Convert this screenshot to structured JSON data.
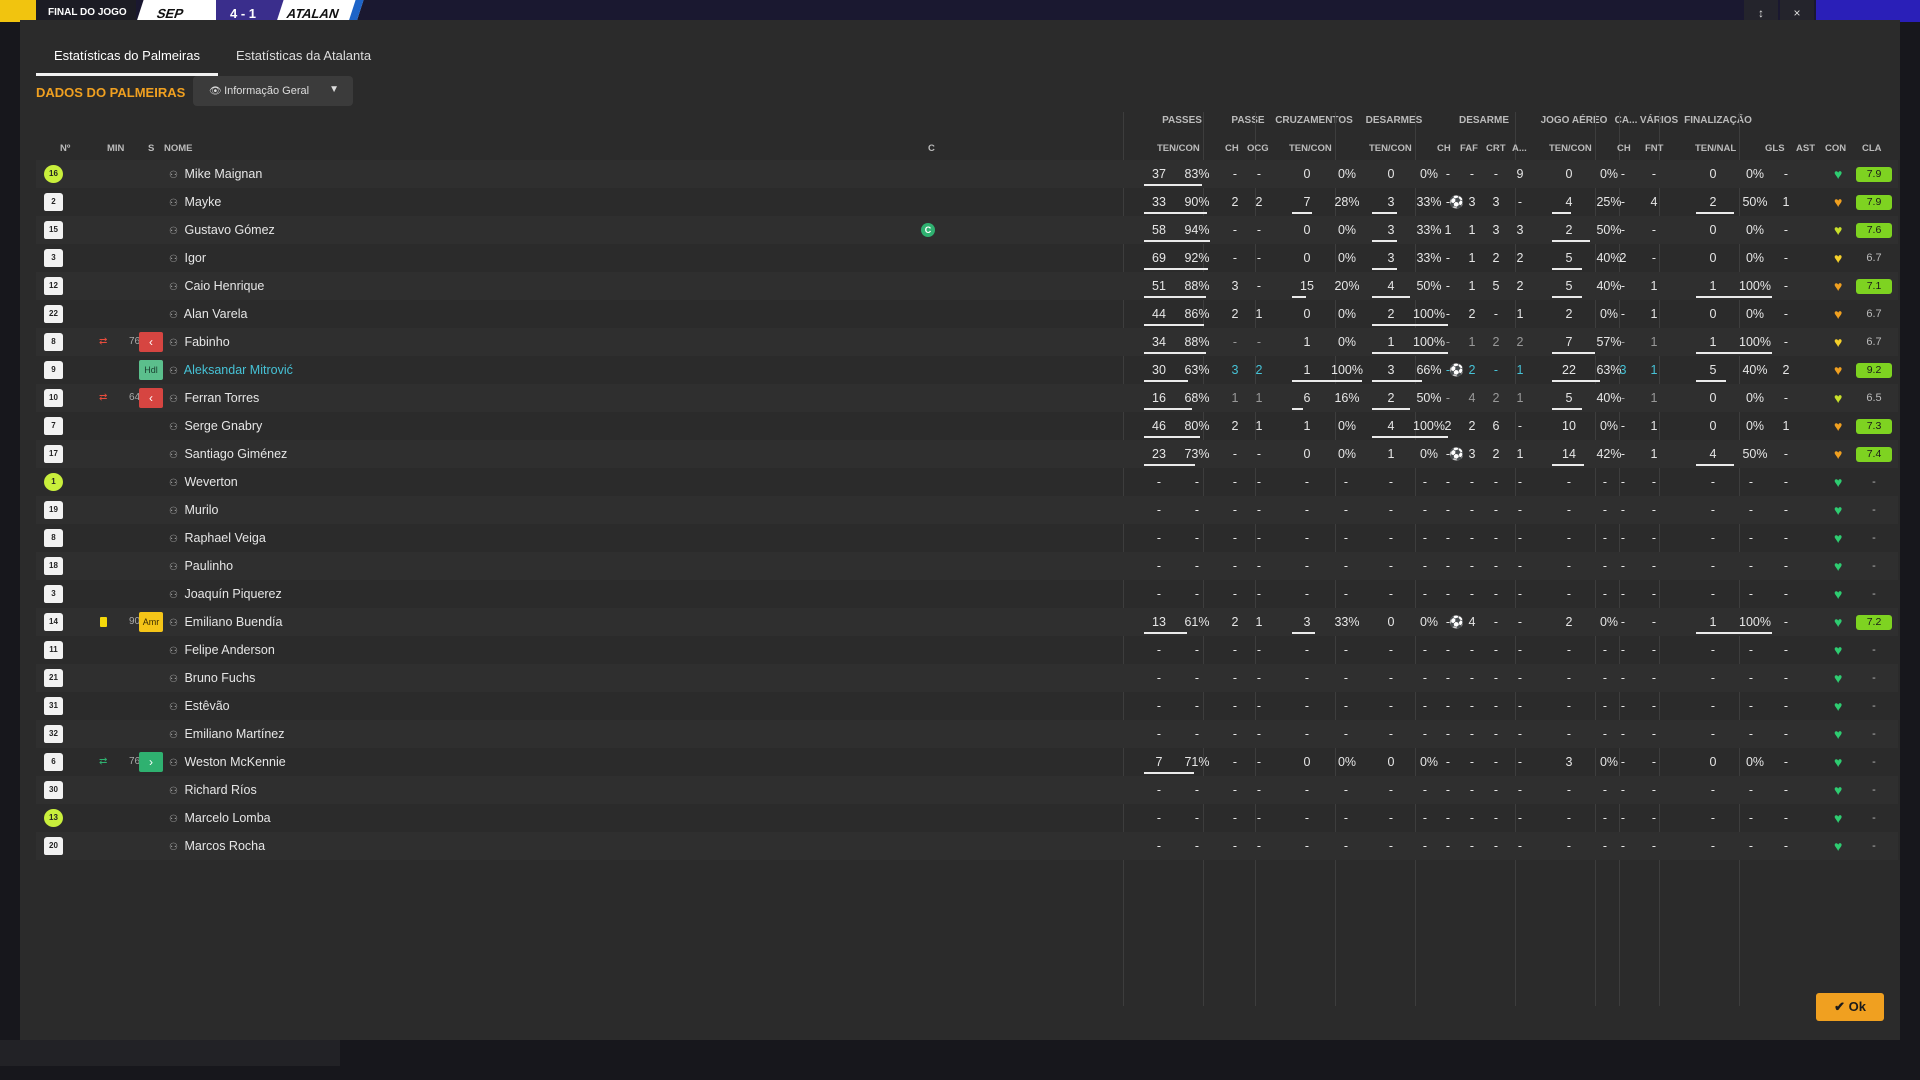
{
  "header": {
    "status": "FINAL DO JOGO",
    "home": "SEP",
    "score": "4 - 1",
    "away": "ATALAN",
    "ctrl_a": "↕",
    "ctrl_b": "×"
  },
  "tabs": [
    {
      "label": "Estatísticas do Palmeiras",
      "active": true
    },
    {
      "label": "Estatísticas da Atalanta",
      "active": false
    }
  ],
  "section_title": "DADOS DO PALMEIRAS",
  "view_select": {
    "value": "Informação Geral",
    "icon": "eye-icon"
  },
  "groups": {
    "passes": "PASSES",
    "passe": "PASSE",
    "cruzamentos": "CRUZAMENTOS",
    "desarmes": "DESARMES",
    "desarme": "DESARME",
    "jogo_aereo": "JOGO AÉREO",
    "ca": "CA...",
    "varios": "VÁRIOS",
    "finalizacao": "FINALIZAÇÃO"
  },
  "columns": {
    "num": "Nº",
    "min": "MIN",
    "s": "S",
    "nome": "NOME",
    "c": "C",
    "passes": "TEN/CON",
    "passe_ch": "CH",
    "passe_ocg": "OCG",
    "cruz": "TEN/CON",
    "des": "TEN/CON",
    "desarme_ch": "CH",
    "faf": "FAF",
    "crt": "CRT",
    "a": "A...",
    "aereo": "TEN/CON",
    "ca_ch": "CH",
    "fnt": "FNT",
    "fin": "TEN/NAL",
    "gls": "GLS",
    "ast": "AST",
    "con": "CON",
    "cla": "CLA"
  },
  "players": [
    {
      "num": "16",
      "gk": true,
      "name": "Mike Maignan",
      "p": [
        "37",
        "83%"
      ],
      "pc": [
        "-",
        "-"
      ],
      "cr": [
        "0",
        "0%"
      ],
      "de": [
        "0",
        "0%"
      ],
      "d2": [
        "-",
        "-",
        "-",
        "9"
      ],
      "ae": [
        "0",
        "0%"
      ],
      "cach": "-",
      "fnt": "-",
      "fi": [
        "0",
        "0%"
      ],
      "gls": "",
      "ast": "-",
      "rating": "7.9",
      "rc": "#7ed321",
      "heart": "#2ecc71",
      "pbar": 0.83,
      "pabar": 0
    },
    {
      "num": "2",
      "name": "Mayke",
      "p": [
        "33",
        "90%"
      ],
      "pc": [
        "2",
        "2"
      ],
      "cr": [
        "7",
        "28%"
      ],
      "de": [
        "3",
        "33%"
      ],
      "d2": [
        "-",
        "3",
        "3",
        "-"
      ],
      "ae": [
        "4",
        "25%"
      ],
      "cach": "-",
      "fnt": "4",
      "fi": [
        "2",
        "50%"
      ],
      "gls": "ball",
      "ast": "1",
      "rating": "7.9",
      "rc": "#7ed321",
      "heart": "#f0a020",
      "pbar": 0.9,
      "crbar": 0.28,
      "debar": 0.33,
      "aebar": 0.25,
      "fibar": 0.5
    },
    {
      "num": "15",
      "name": "Gustavo Gómez",
      "cap": "C",
      "p": [
        "58",
        "94%"
      ],
      "pc": [
        "-",
        "-"
      ],
      "cr": [
        "0",
        "0%"
      ],
      "de": [
        "3",
        "33%"
      ],
      "d2": [
        "1",
        "1",
        "3",
        "3"
      ],
      "ae": [
        "2",
        "50%"
      ],
      "cach": "-",
      "fnt": "-",
      "fi": [
        "0",
        "0%"
      ],
      "gls": "",
      "ast": "-",
      "rating": "7.6",
      "rc": "#7ed321",
      "heart": "#c8e02a",
      "pbar": 0.94,
      "debar": 0.33,
      "aebar": 0.5
    },
    {
      "num": "3",
      "name": "Igor",
      "p": [
        "69",
        "92%"
      ],
      "pc": [
        "-",
        "-"
      ],
      "cr": [
        "0",
        "0%"
      ],
      "de": [
        "3",
        "33%"
      ],
      "d2": [
        "-",
        "1",
        "2",
        "2"
      ],
      "ae": [
        "5",
        "40%"
      ],
      "cach": "2",
      "fnt": "-",
      "fi": [
        "0",
        "0%"
      ],
      "gls": "",
      "ast": "-",
      "rating": "6.7",
      "rc": "",
      "heart": "#f5d02a",
      "pbar": 0.92,
      "debar": 0.33,
      "aebar": 0.4
    },
    {
      "num": "12",
      "name": "Caio Henrique",
      "p": [
        "51",
        "88%"
      ],
      "pc": [
        "3",
        "-"
      ],
      "cr": [
        "15",
        "20%"
      ],
      "de": [
        "4",
        "50%"
      ],
      "d2": [
        "-",
        "1",
        "5",
        "2"
      ],
      "ae": [
        "5",
        "40%"
      ],
      "cach": "-",
      "fnt": "1",
      "fi": [
        "1",
        "100%"
      ],
      "gls": "",
      "ast": "-",
      "rating": "7.1",
      "rc": "#7ed321",
      "heart": "#f0a020",
      "pbar": 0.88,
      "crbar": 0.2,
      "debar": 0.5,
      "aebar": 0.4,
      "fibar": 1
    },
    {
      "num": "22",
      "name": "Alan Varela",
      "p": [
        "44",
        "86%"
      ],
      "pc": [
        "2",
        "1"
      ],
      "cr": [
        "0",
        "0%"
      ],
      "de": [
        "2",
        "100%"
      ],
      "d2": [
        "-",
        "2",
        "-",
        "1"
      ],
      "ae": [
        "2",
        "0%"
      ],
      "cach": "-",
      "fnt": "1",
      "fi": [
        "0",
        "0%"
      ],
      "gls": "",
      "ast": "-",
      "rating": "6.7",
      "rc": "",
      "heart": "#f0a020",
      "pbar": 0.86,
      "debar": 1
    },
    {
      "num": "8",
      "name": "Fabinho",
      "sub": "out",
      "min": "76",
      "p": [
        "34",
        "88%"
      ],
      "pc": [
        "-",
        "-"
      ],
      "cr": [
        "1",
        "0%"
      ],
      "de": [
        "1",
        "100%"
      ],
      "d2": [
        "-",
        "1",
        "2",
        "2"
      ],
      "ae": [
        "7",
        "57%"
      ],
      "cach": "-",
      "fnt": "1",
      "fi": [
        "1",
        "100%"
      ],
      "gls": "",
      "ast": "-",
      "rating": "6.7",
      "rc": "",
      "heart": "#f5d02a",
      "pbar": 0.88,
      "debar": 1,
      "aebar": 0.57,
      "fibar": 1,
      "dim": true
    },
    {
      "num": "9",
      "name": "Aleksandar Mitrović",
      "tag": "Hdl",
      "link": true,
      "p": [
        "30",
        "63%"
      ],
      "pc": [
        "3",
        "2"
      ],
      "cr": [
        "1",
        "100%"
      ],
      "de": [
        "3",
        "66%"
      ],
      "d2": [
        "-",
        "2",
        "-",
        "1"
      ],
      "ae": [
        "22",
        "63%"
      ],
      "cach": "3",
      "fnt": "1",
      "fi": [
        "5",
        "40%"
      ],
      "gls": "ball",
      "ast": "2",
      "rating": "9.2",
      "rc": "#7ed321",
      "heart": "#f0a020",
      "pbar": 0.63,
      "crbar": 1,
      "debar": 0.66,
      "aebar": 0.63,
      "fibar": 0.4,
      "teal": true
    },
    {
      "num": "10",
      "name": "Ferran Torres",
      "sub": "out",
      "min": "64",
      "p": [
        "16",
        "68%"
      ],
      "pc": [
        "1",
        "1"
      ],
      "cr": [
        "6",
        "16%"
      ],
      "de": [
        "2",
        "50%"
      ],
      "d2": [
        "-",
        "4",
        "2",
        "1"
      ],
      "ae": [
        "5",
        "40%"
      ],
      "cach": "-",
      "fnt": "1",
      "fi": [
        "0",
        "0%"
      ],
      "gls": "",
      "ast": "-",
      "rating": "6.5",
      "rc": "",
      "heart": "#c8e02a",
      "pbar": 0.68,
      "crbar": 0.16,
      "debar": 0.5,
      "aebar": 0.4,
      "dim": true
    },
    {
      "num": "7",
      "name": "Serge Gnabry",
      "p": [
        "46",
        "80%"
      ],
      "pc": [
        "2",
        "1"
      ],
      "cr": [
        "1",
        "0%"
      ],
      "de": [
        "4",
        "100%"
      ],
      "d2": [
        "2",
        "2",
        "6",
        "-"
      ],
      "ae": [
        "10",
        "0%"
      ],
      "cach": "-",
      "fnt": "1",
      "fi": [
        "0",
        "0%"
      ],
      "gls": "",
      "ast": "1",
      "rating": "7.3",
      "rc": "#7ed321",
      "heart": "#f0a020",
      "pbar": 0.8,
      "debar": 1
    },
    {
      "num": "17",
      "name": "Santiago Giménez",
      "p": [
        "23",
        "73%"
      ],
      "pc": [
        "-",
        "-"
      ],
      "cr": [
        "0",
        "0%"
      ],
      "de": [
        "1",
        "0%"
      ],
      "d2": [
        "-",
        "3",
        "2",
        "1"
      ],
      "ae": [
        "14",
        "42%"
      ],
      "cach": "-",
      "fnt": "1",
      "fi": [
        "4",
        "50%"
      ],
      "gls": "ball",
      "ast": "-",
      "rating": "7.4",
      "rc": "#7ed321",
      "heart": "#f0a020",
      "pbar": 0.73,
      "aebar": 0.42,
      "fibar": 0.5
    },
    {
      "num": "1",
      "gk": true,
      "name": "Weverton",
      "empty": true
    },
    {
      "num": "19",
      "name": "Murilo",
      "empty": true
    },
    {
      "num": "8",
      "name": "Raphael Veiga",
      "empty": true
    },
    {
      "num": "18",
      "name": "Paulinho",
      "empty": true
    },
    {
      "num": "3",
      "name": "Joaquín Piquerez",
      "empty": true
    },
    {
      "num": "14",
      "name": "Emiliano Buendía",
      "card": true,
      "min": "90",
      "tag2": "Amr",
      "p": [
        "13",
        "61%"
      ],
      "pc": [
        "2",
        "1"
      ],
      "cr": [
        "3",
        "33%"
      ],
      "de": [
        "0",
        "0%"
      ],
      "d2": [
        "-",
        "4",
        "-",
        "-"
      ],
      "ae": [
        "2",
        "0%"
      ],
      "cach": "-",
      "fnt": "-",
      "fi": [
        "1",
        "100%"
      ],
      "gls": "ball",
      "ast": "-",
      "rating": "7.2",
      "rc": "#7ed321",
      "heart": "#2ecc71",
      "pbar": 0.61,
      "crbar": 0.33,
      "fibar": 1
    },
    {
      "num": "11",
      "name": "Felipe Anderson",
      "empty": true
    },
    {
      "num": "21",
      "name": "Bruno Fuchs",
      "empty": true
    },
    {
      "num": "31",
      "name": "Estêvão",
      "empty": true
    },
    {
      "num": "32",
      "name": "Emiliano Martínez",
      "empty": true
    },
    {
      "num": "6",
      "name": "Weston McKennie",
      "sub": "in",
      "min": "76",
      "p": [
        "7",
        "71%"
      ],
      "pc": [
        "-",
        "-"
      ],
      "cr": [
        "0",
        "0%"
      ],
      "de": [
        "0",
        "0%"
      ],
      "d2": [
        "-",
        "-",
        "-",
        "-"
      ],
      "ae": [
        "3",
        "0%"
      ],
      "cach": "-",
      "fnt": "-",
      "fi": [
        "0",
        "0%"
      ],
      "gls": "",
      "ast": "-",
      "rating": "-",
      "rc": "",
      "heart": "#2ecc71",
      "pbar": 0.71
    },
    {
      "num": "30",
      "name": "Richard Ríos",
      "empty": true
    },
    {
      "num": "13",
      "gk": true,
      "name": "Marcelo Lomba",
      "empty": true
    },
    {
      "num": "20",
      "name": "Marcos Rocha",
      "empty": true
    }
  ],
  "ok_label": "Ok",
  "colors": {
    "accent": "#f0a020",
    "panel": "#2b2b2b",
    "link": "#46c2d6"
  }
}
